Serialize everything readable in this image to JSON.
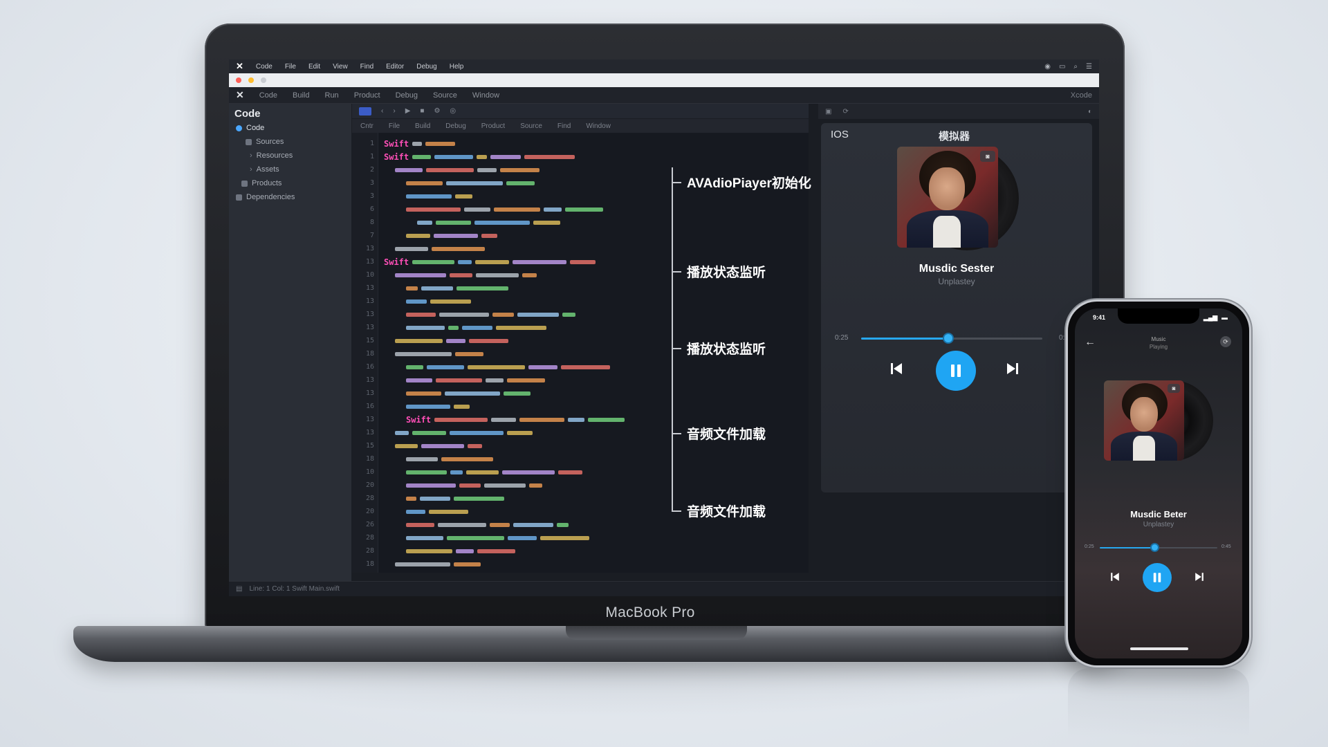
{
  "laptop": {
    "brand_label": "MacBook Pro"
  },
  "menubar": {
    "app": "Code",
    "items": [
      "File",
      "Edit",
      "View",
      "Find",
      "Editor",
      "Debug",
      "Help"
    ]
  },
  "toolbar": {
    "left": "Code",
    "items": [
      "Build",
      "Run",
      "Product",
      "Debug",
      "Source",
      "Window"
    ],
    "right": "Xcode"
  },
  "sidebar": {
    "title": "Code",
    "items": [
      {
        "label": "Code"
      },
      {
        "label": "Sources"
      },
      {
        "label": "Resources"
      },
      {
        "label": "Assets"
      },
      {
        "label": "Products"
      },
      {
        "label": "Dependencies"
      }
    ]
  },
  "editor": {
    "tabs": [
      "Cntr",
      "File",
      "Build",
      "Debug",
      "Product",
      "Source",
      "Find",
      "Window"
    ],
    "keyword": "Swift",
    "line_numbers": [
      "1",
      "1",
      "2",
      "3",
      "3",
      "6",
      "8",
      "7",
      "13",
      "13",
      "10",
      "13",
      "13",
      "13",
      "13",
      "15",
      "18",
      "16",
      "13",
      "13",
      "16",
      "13",
      "13",
      "15",
      "18",
      "10",
      "20",
      "28",
      "20",
      "26",
      "28",
      "28",
      "18"
    ]
  },
  "annotations": [
    {
      "label": "AVAdioPiayer初始化"
    },
    {
      "label": "播放状态监听"
    },
    {
      "label": "播放状态监听"
    },
    {
      "label": "音频文件加载"
    },
    {
      "label": "音频文件加载"
    }
  ],
  "simulator": {
    "tab_ios": "IOS",
    "tab_sim": "模拟器",
    "song_title": "Musdic Sester",
    "artist": "Unplastey",
    "time_elapsed": "0:25",
    "time_total": "0:45",
    "progress": 0.48
  },
  "phone": {
    "time": "9:41",
    "header_title": "Music",
    "header_subtitle": "Playing",
    "song_title": "Musdic Beter",
    "artist": "Unplastey",
    "time_elapsed": "0:25",
    "time_total": "0:45",
    "progress": 0.47
  },
  "statusbar": {
    "text": "Line: 1  Col: 1   Swift   Main.swift"
  },
  "colors": {
    "accent": "#1fa5f3",
    "editor_bg": "#161920",
    "keyword": "#ff4fb8"
  }
}
